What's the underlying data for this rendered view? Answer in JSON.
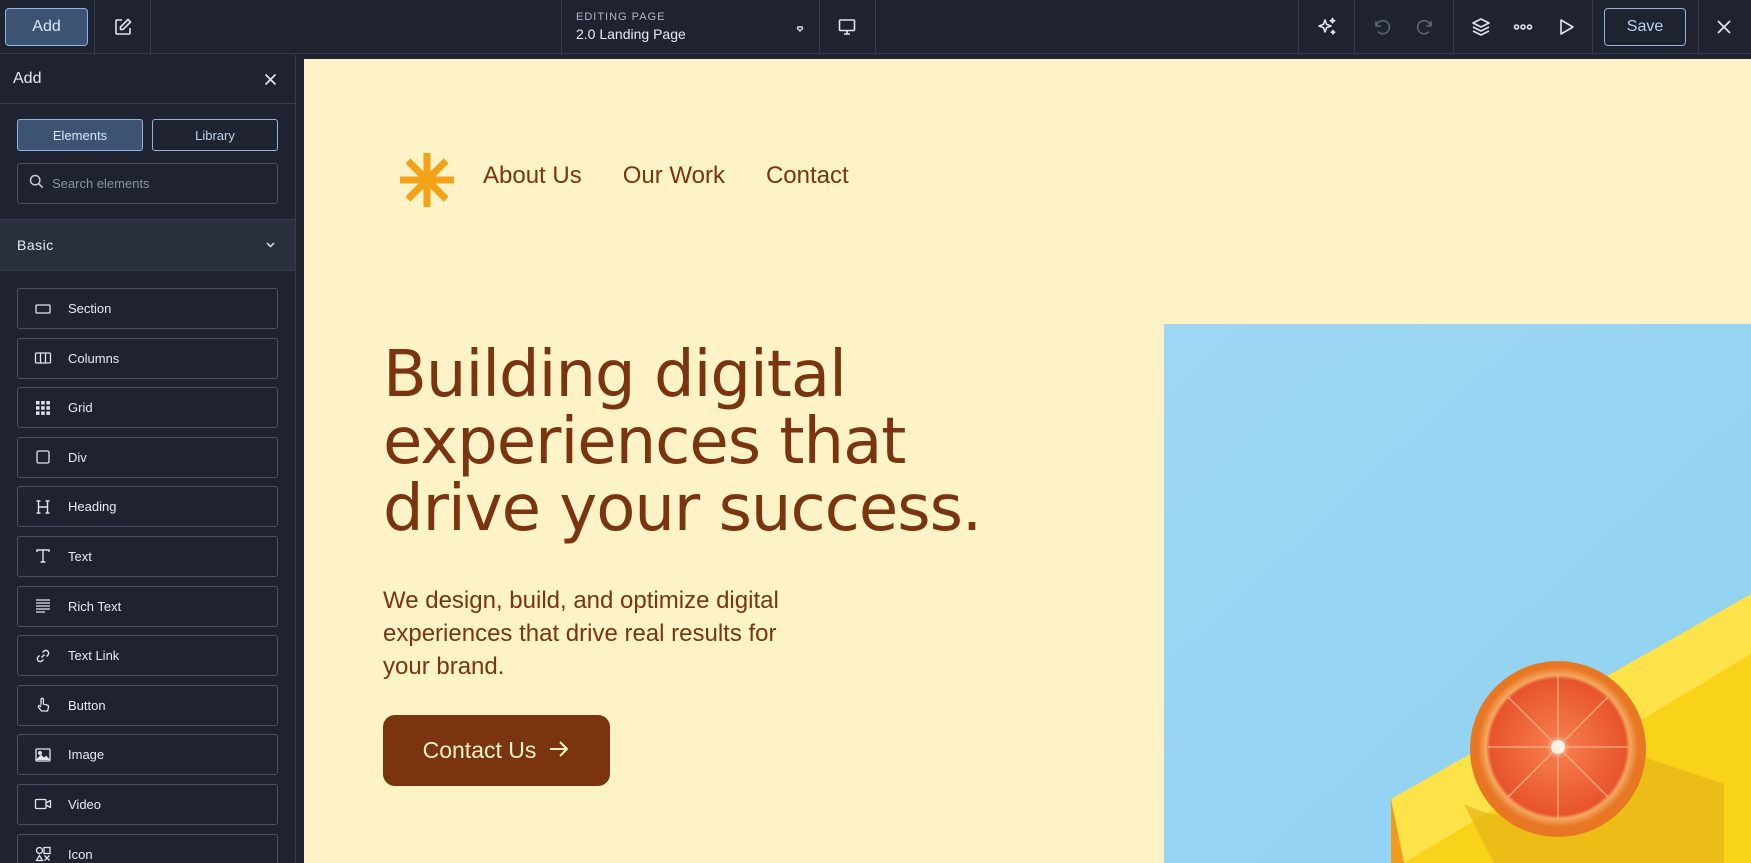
{
  "toolbar": {
    "add_label": "Add",
    "editing_caption": "EDITING PAGE",
    "page_name": "2.0 Landing Page",
    "save_label": "Save"
  },
  "panel": {
    "title": "Add",
    "tabs": [
      {
        "label": "Elements",
        "active": true
      },
      {
        "label": "Library",
        "active": false
      }
    ],
    "search_placeholder": "Search elements",
    "section_label": "Basic",
    "items": [
      {
        "label": "Section",
        "icon": "section-icon"
      },
      {
        "label": "Columns",
        "icon": "columns-icon"
      },
      {
        "label": "Grid",
        "icon": "grid-icon"
      },
      {
        "label": "Div",
        "icon": "div-icon"
      },
      {
        "label": "Heading",
        "icon": "heading-icon"
      },
      {
        "label": "Text",
        "icon": "text-icon"
      },
      {
        "label": "Rich Text",
        "icon": "rich-text-icon"
      },
      {
        "label": "Text Link",
        "icon": "link-icon"
      },
      {
        "label": "Button",
        "icon": "pointer-hand-icon"
      },
      {
        "label": "Image",
        "icon": "image-icon"
      },
      {
        "label": "Video",
        "icon": "video-icon"
      },
      {
        "label": "Icon",
        "icon": "icon-element-icon"
      }
    ]
  },
  "site": {
    "nav": [
      "About Us",
      "Our Work",
      "Contact"
    ],
    "hero_title_lines": [
      "Building digital",
      "experiences that",
      "drive your success."
    ],
    "hero_text": "We design, build, and optimize digital experiences that drive real results for your brand.",
    "cta_label": "Contact Us"
  },
  "colors": {
    "chrome_bg": "#1f2330",
    "accent_blue": "#8fb4e2",
    "site_bg": "#fef3c6",
    "site_brown": "#7a3410",
    "logo_orange": "#f4a21a"
  }
}
